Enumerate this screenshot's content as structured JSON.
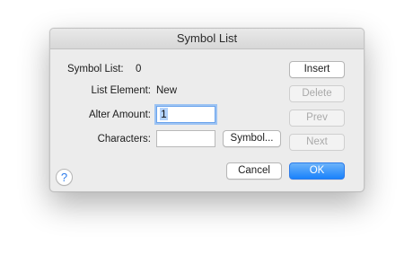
{
  "dialog": {
    "title": "Symbol List"
  },
  "fields": {
    "symbol_list_label": "Symbol List:",
    "symbol_list_value": "0",
    "list_element_label": "List Element:",
    "list_element_value": "New",
    "alter_amount_label": "Alter Amount:",
    "alter_amount_value": "1",
    "characters_label": "Characters:",
    "characters_value": ""
  },
  "buttons": {
    "insert": "Insert",
    "delete": "Delete",
    "prev": "Prev",
    "next": "Next",
    "symbol": "Symbol...",
    "cancel": "Cancel",
    "ok": "OK",
    "help": "?"
  },
  "colors": {
    "accent": "#1a82fb",
    "focus_ring": "#9cc3f3",
    "selection": "#b3d2fb",
    "dialog_bg": "#ececec"
  }
}
